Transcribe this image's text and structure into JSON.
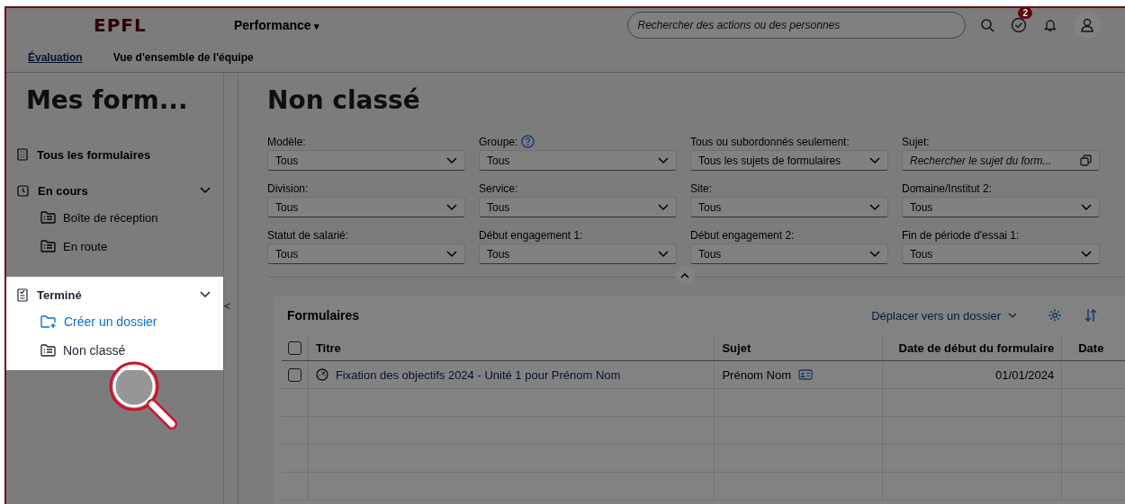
{
  "header": {
    "logo": "EPFL",
    "app_menu": "Performance",
    "app_menu_caret": "▾",
    "search": {
      "placeholder": "Rechercher des actions ou des personnes"
    },
    "todo_badge": "2"
  },
  "nav_tabs": [
    {
      "label": "Évaluation",
      "selected": true
    },
    {
      "label": "Vue d'ensemble de l'équipe",
      "selected": false
    }
  ],
  "sidebar": {
    "title": "Mes form...",
    "collapse_glyph": "<",
    "items": [
      {
        "label": "Tous les formulaires",
        "kind": "all"
      },
      {
        "label": "En cours",
        "kind": "clock",
        "expanded": true,
        "children": [
          {
            "label": "Boîte de réception",
            "kind": "folder"
          },
          {
            "label": "En route",
            "kind": "folder"
          }
        ]
      },
      {
        "label": "Terminé",
        "kind": "done",
        "expanded": true,
        "highlighted": true,
        "children": [
          {
            "label": "Créer un dossier",
            "kind": "create"
          },
          {
            "label": "Non classé",
            "kind": "folder"
          }
        ]
      }
    ]
  },
  "page_title": "Non classé",
  "filters": [
    {
      "label": "Modèle:",
      "value": "Tous"
    },
    {
      "label": "Groupe:",
      "value": "Tous",
      "help": true
    },
    {
      "label": "Tous ou subordonnés seulement:",
      "value": "Tous les sujets de formulaires"
    },
    {
      "label": "Sujet:",
      "placeholder": "Rechercher le sujet du form...",
      "kind": "search"
    },
    {
      "label": "Division:",
      "value": "Tous"
    },
    {
      "label": "Service:",
      "value": "Tous"
    },
    {
      "label": "Site:",
      "value": "Tous"
    },
    {
      "label": "Domaine/Institut 2:",
      "value": "Tous"
    },
    {
      "label": "Statut de salarié:",
      "value": "Tous"
    },
    {
      "label": "Début engagement 1:",
      "value": "Tous"
    },
    {
      "label": "Début engagement 2:",
      "value": "Tous"
    },
    {
      "label": "Fin de période d'essai 1:",
      "value": "Tous"
    }
  ],
  "table": {
    "title": "Formulaires",
    "select_all_checked": false,
    "move_action": "Déplacer vers un dossier",
    "columns": [
      "Titre",
      "Sujet",
      "Date de début du formulaire",
      "Date"
    ],
    "rows": [
      {
        "checked": false,
        "title": "Fixation des objectifs 2024 - Unité 1 pour Prénom Nom",
        "subject": "Prénom Nom",
        "start_date": "01/01/2024"
      }
    ]
  }
}
